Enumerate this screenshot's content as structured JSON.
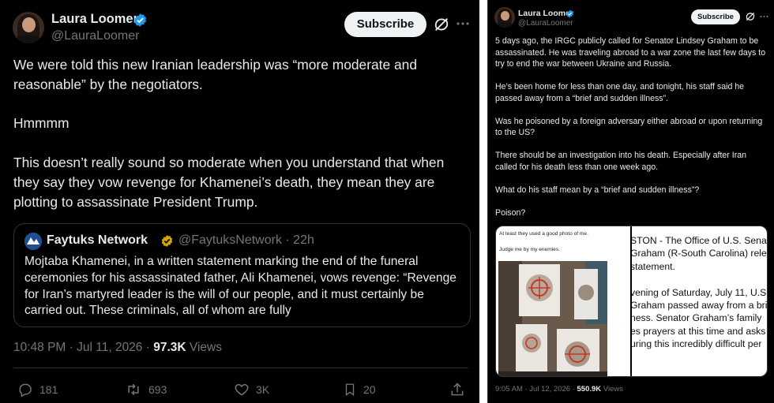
{
  "left_post": {
    "author_name": "Laura Loomer",
    "author_handle": "@LauraLoomer",
    "subscribe_label": "Subscribe",
    "body": "We were told this new Iranian leadership was “more moderate and reasonable” by the negotiators.\n\nHmmmm\n\nThis doesn’t really sound so moderate when you understand that when they say they vow revenge for Khamenei’s death, they mean they are plotting to assassinate President Trump.",
    "quote": {
      "name": "Faytuks Network",
      "handle": "@FaytuksNetwork",
      "age": "· 22h",
      "text": "Mojtaba Khamenei, in a written statement marking the end of the funeral ceremonies for his assassinated father, Ali Khamenei, vows revenge: “Revenge for Iran’s martyred leader is the will of our people, and it must certainly be carried out. These criminals, all of whom are fully"
    },
    "timestamp": "10:48 PM · Jul 11, 2026 ·",
    "views_count": "97.3K",
    "views_label": "Views",
    "actions": {
      "replies": "181",
      "reposts": "693",
      "likes": "3K",
      "bookmarks": "20"
    }
  },
  "right_post": {
    "author_name": "Laura Loomer",
    "author_handle": "@LauraLoomer",
    "subscribe_label": "Subscribe",
    "body": "5 days ago, the IRGC publicly called for Senator Lindsey Graham to be assassinated. He was traveling abroad to a war zone the last few days to try to end the war between Ukraine and Russia.\n\nHe’s been home for less than one day, and tonight, his staff said he passed away from a “brief and sudden illness”.\n\nWas he poisoned by a foreign adversary either abroad or upon returning to the US?\n\nThere should be an investigation into his death. Especially after Iran called for his death less than one week ago.\n\nWhat do his staff mean by a “brief and sudden illness”?\n\nPoison?",
    "media_left": {
      "caption_1": "At least they used a good photo of me.",
      "caption_2": "Judge me by my enemies."
    },
    "media_right_text": "STON - The Office of U.S. Senat\nGraham (R-South Carolina) relea\nstatement.\n\nvening of Saturday, July 11, U.S.\nGraham passed away from a brie\nness. Senator Graham’s family\nes prayers at this time and asks\nuring this incredibly difficult per",
    "timestamp": "9:05 AM · Jul 12, 2026 ·",
    "views_count": "550.9K",
    "views_label": "Views"
  },
  "colors": {
    "background": "#000000",
    "text": "#e7e9ea",
    "muted": "#71767b",
    "verified_blue": "#1d9bf0",
    "border": "#2f3336"
  }
}
